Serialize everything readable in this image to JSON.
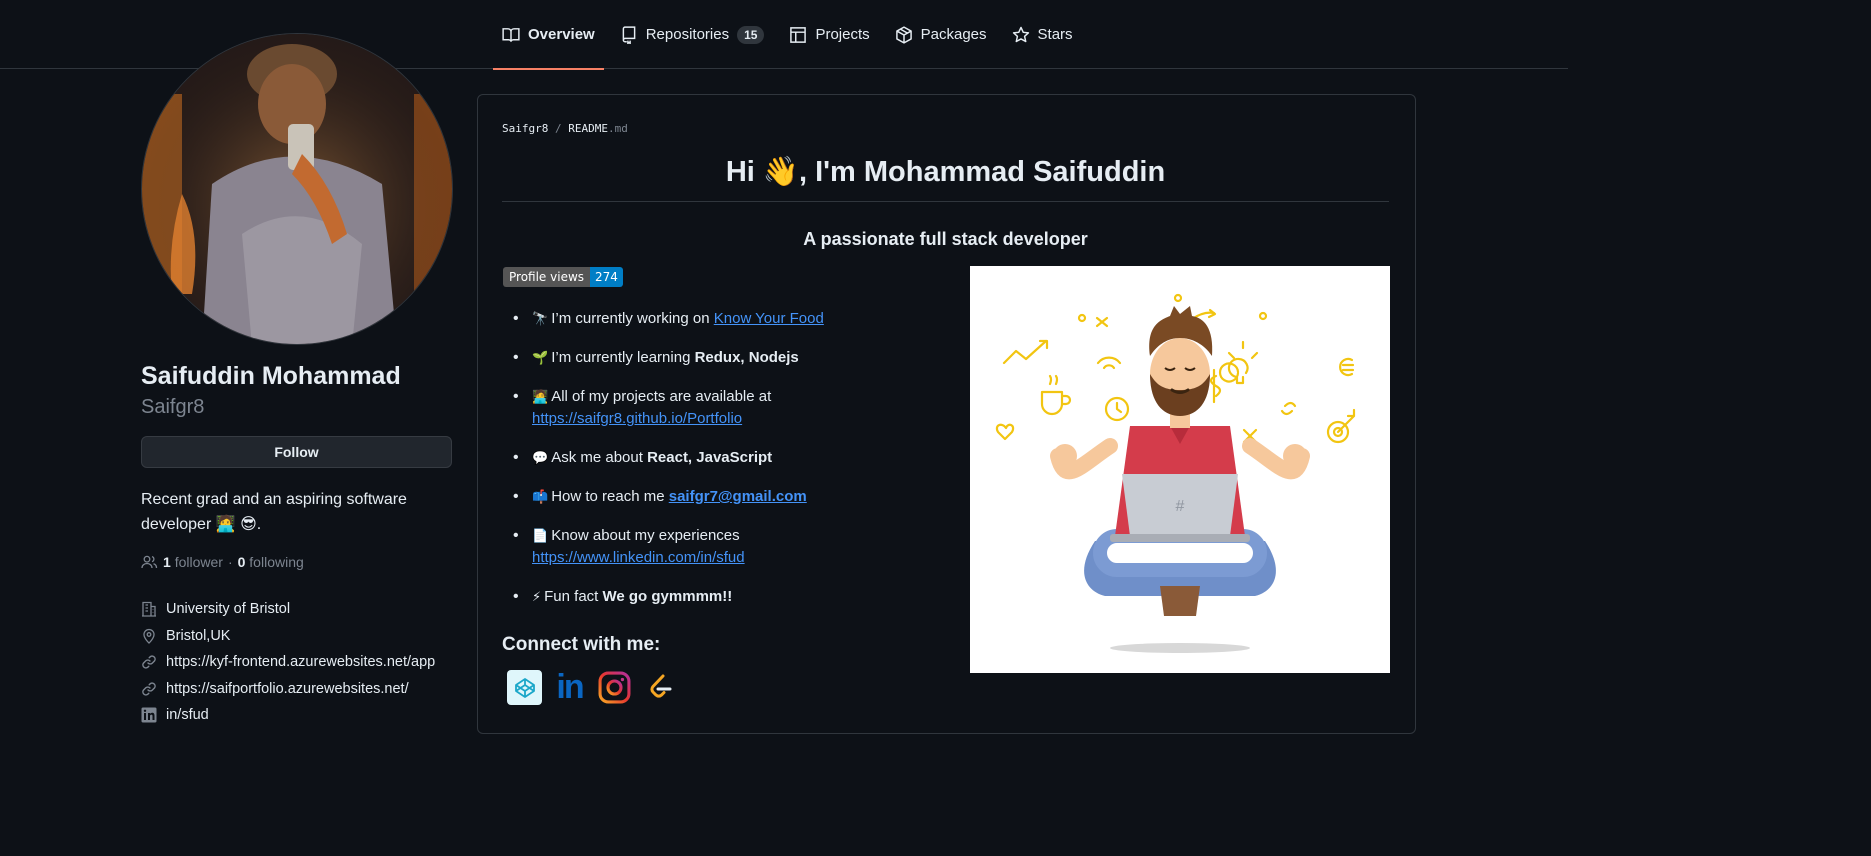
{
  "tabs": [
    {
      "label": "Overview",
      "icon": "book-icon"
    },
    {
      "label": "Repositories",
      "icon": "repo-icon",
      "count": "15"
    },
    {
      "label": "Projects",
      "icon": "table-icon"
    },
    {
      "label": "Packages",
      "icon": "package-icon"
    },
    {
      "label": "Stars",
      "icon": "star-icon"
    }
  ],
  "profile": {
    "name": "Saifuddin Mohammad",
    "login": "Saifgr8",
    "follow_label": "Follow",
    "bio": "Recent grad and an aspiring software developer 🧑‍💻 😎.",
    "followers_count": "1",
    "followers_label": "follower",
    "separator": "·",
    "following_count": "0",
    "following_label": "following",
    "organization": "University of Bristol",
    "location": "Bristol,UK",
    "link1": "https://kyf-frontend.azurewebsites.net/app",
    "link2": "https://saifportfolio.azurewebsites.net/",
    "linkedin": "in/sfud"
  },
  "readme": {
    "crumb_owner": "Saifgr8",
    "crumb_sep": "/",
    "crumb_file": "README",
    "crumb_ext": ".md",
    "heading": "Hi 👋, I'm Mohammad Saifuddin",
    "subheading": "A passionate full stack developer",
    "badge_label": "Profile views",
    "badge_value": "274",
    "items": {
      "working_emoji": "🔭",
      "working_text": "I’m currently working on ",
      "working_link": "Know Your Food",
      "learning_emoji": "🌱",
      "learning_text": "I’m currently learning ",
      "learning_bold": "Redux, Nodejs",
      "projects_emoji": "🧑‍💻",
      "projects_text": "All of my projects are available at",
      "projects_link": "https://saifgr8.github.io/Portfolio",
      "ask_emoji": "💬",
      "ask_text": "Ask me about ",
      "ask_bold": "React, JavaScript",
      "reach_emoji": "📫",
      "reach_text": "How to reach me ",
      "reach_link": "saifgr7@gmail.com",
      "exp_emoji": "📄",
      "exp_text": "Know about my experiences",
      "exp_link": "https://www.linkedin.com/in/sfud",
      "fun_emoji": "⚡",
      "fun_text": "Fun fact ",
      "fun_bold": "We go gymmmm!!"
    },
    "connect_heading": "Connect with me:",
    "social_linkedin": "in",
    "social_hash": "#"
  },
  "colors": {
    "background": "#0d1117",
    "border": "#30363d",
    "accent_underline": "#f78166",
    "link": "#4493f8",
    "badge_right": "#007ec6"
  }
}
